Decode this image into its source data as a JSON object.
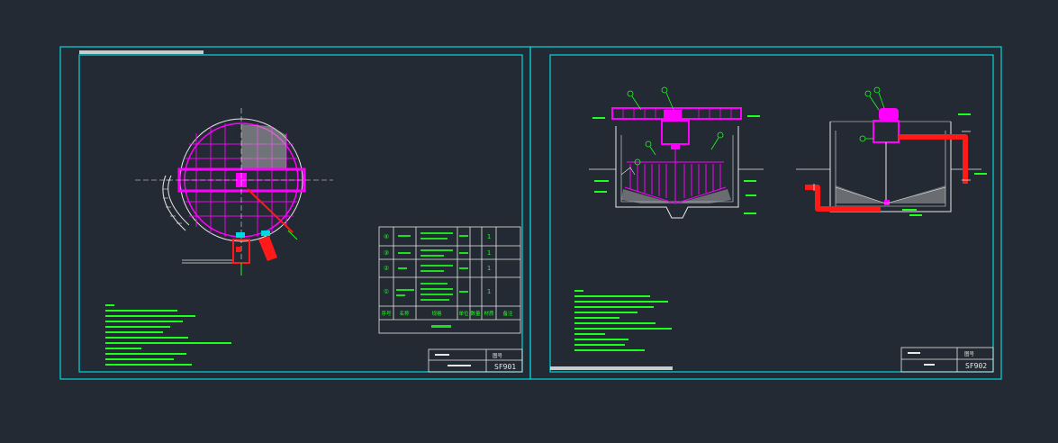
{
  "colors": {
    "background": "#232a33",
    "frame": "#00d8e0",
    "equipment": "#ff00ff",
    "pipe": "#ff1a1a",
    "annotation": "#1dff1d",
    "white": "#e8e8e8",
    "grey": "#9aa0a6"
  },
  "sheet1": {
    "drawing_number": "SF901",
    "title_cell": "",
    "company_cell": "",
    "drawing_label": "图号",
    "table": {
      "rows": [
        {
          "no": "④",
          "name": "",
          "spec": "",
          "unit": "",
          "qty": "1"
        },
        {
          "no": "③",
          "name": "",
          "spec": "",
          "unit": "",
          "qty": "1"
        },
        {
          "no": "②",
          "name": "",
          "spec": "",
          "unit": "",
          "qty": "1"
        },
        {
          "no": "①",
          "name": "",
          "spec": "",
          "unit": "",
          "qty": "1"
        }
      ],
      "header": {
        "no": "序号",
        "name": "名称",
        "spec": "规格",
        "unit": "单位",
        "qty": "数量",
        "material": "材质",
        "note": "备注"
      },
      "caption": ""
    }
  },
  "sheet2": {
    "drawing_number": "SF902",
    "title_cell": "",
    "company_cell": "",
    "drawing_label": "图号"
  }
}
